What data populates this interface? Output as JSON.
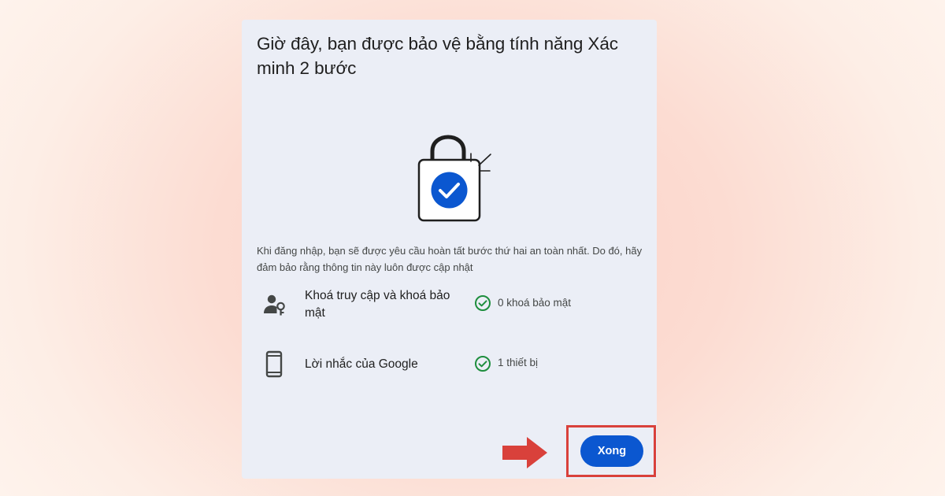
{
  "dialog": {
    "title": "Giờ đây, bạn được bảo vệ bằng tính năng Xác minh 2 bước",
    "description": "Khi đăng nhập, bạn sẽ được yêu cầu hoàn tất bước thứ hai an toàn nhất. Do đó, hãy đảm bảo rằng thông tin này luôn được cập nhật",
    "methods": [
      {
        "icon": "person-key-icon",
        "label": "Khoá truy cập và khoá bảo mật",
        "status": "0 khoá bảo mật",
        "status_icon": "check-circle-icon"
      },
      {
        "icon": "phone-icon",
        "label": "Lời nhắc của Google",
        "status": "1 thiết bị",
        "status_icon": "check-circle-icon"
      }
    ],
    "done_button_label": "Xong"
  },
  "annotation": {
    "arrow_icon": "arrow-right-icon",
    "highlight_color": "#d9413b"
  },
  "colors": {
    "accent": "#0b57d0",
    "success": "#1e8e3e",
    "dialog_background": "#ebeef6"
  }
}
